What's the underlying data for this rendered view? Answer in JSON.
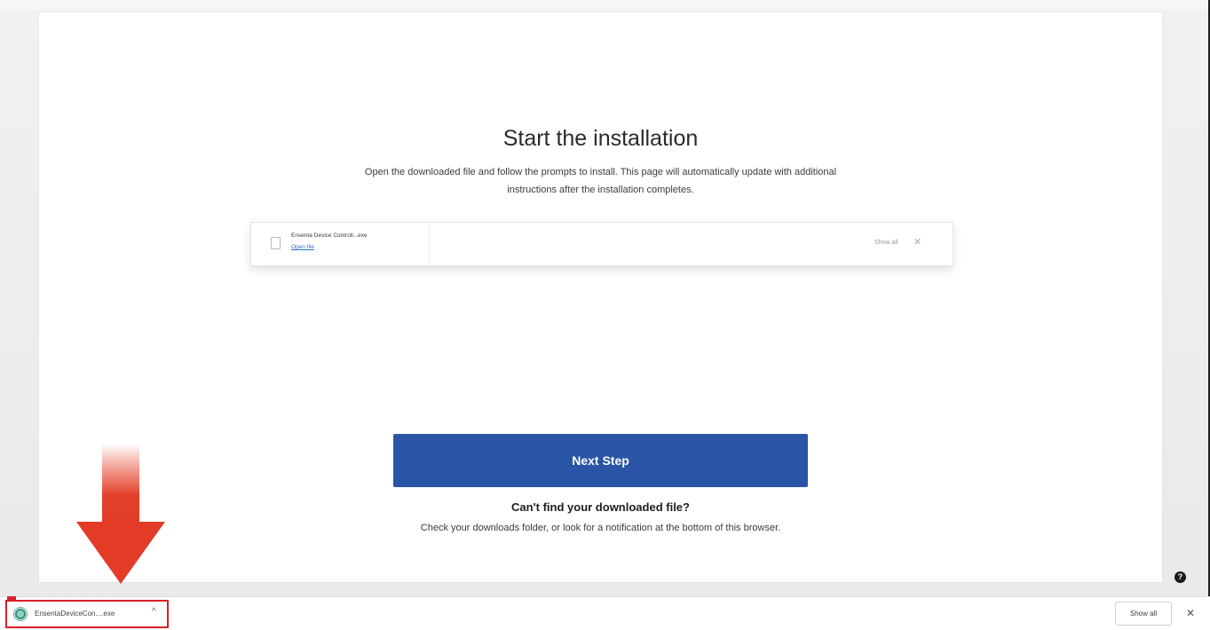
{
  "page": {
    "title": "Start the installation",
    "description": "Open the downloaded file and follow the prompts to install. This page will automatically update with additional instructions after the installation completes."
  },
  "illustration": {
    "file_name": "Ensenta Device Controll...exe",
    "open_link": "Open file",
    "show_all_label": "Show all",
    "close_glyph": "✕",
    "file_icon": "file-icon"
  },
  "actions": {
    "next_step_label": "Next Step"
  },
  "help": {
    "heading": "Can't find your downloaded file?",
    "text": "Check your downloads folder, or look for a notification at the bottom of this browser.",
    "corner_icon_glyph": "?"
  },
  "annotation": {
    "arrow_color": "#e23c27",
    "highlight_color": "#d8202a"
  },
  "download_bar": {
    "file_name": "EnsentaDeviceCon....exe",
    "chevron_glyph": "^",
    "show_all_label": "Show all",
    "close_glyph": "✕",
    "app_icon": "ensenta-app-icon"
  },
  "colors": {
    "primary_button": "#2a55a6",
    "link": "#2f6fd0"
  }
}
